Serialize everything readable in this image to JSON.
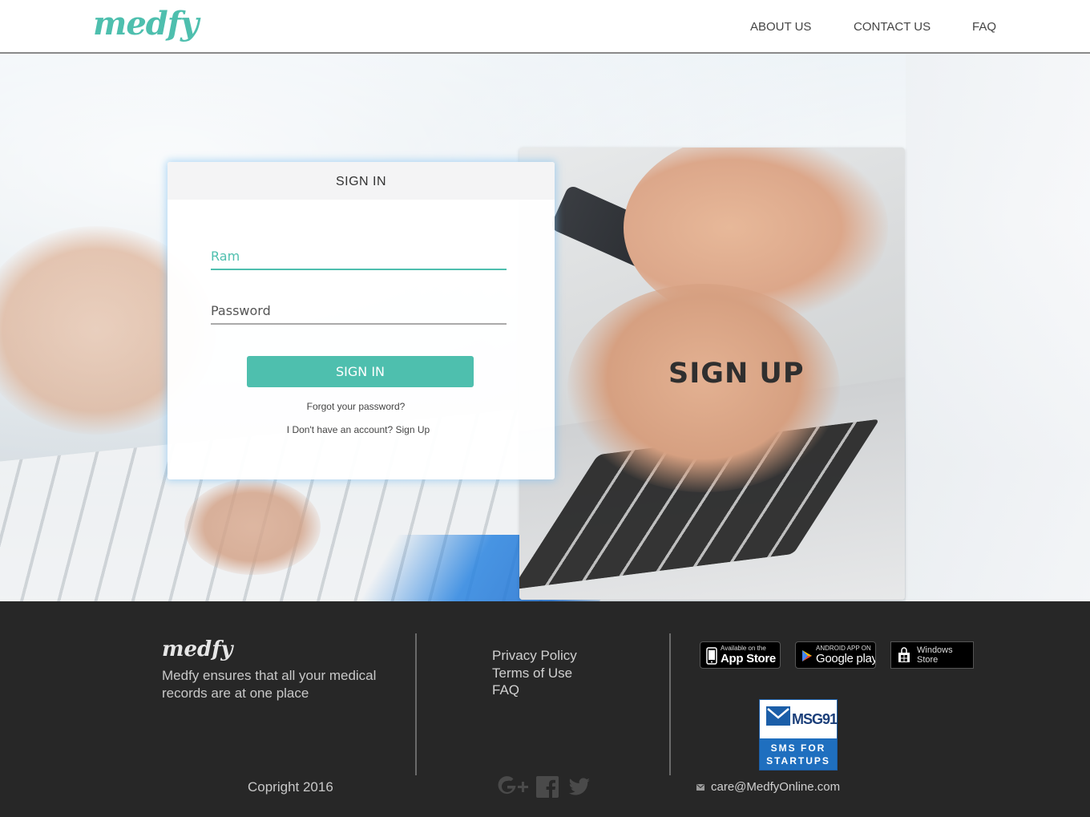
{
  "header": {
    "logo": "medfy",
    "nav": {
      "about": "ABOUT US",
      "contact": "CONTACT US",
      "faq": "FAQ"
    }
  },
  "signup_panel": {
    "title": "SIGN UP"
  },
  "signin": {
    "title": "SIGN IN",
    "username_value": "Ram",
    "password_placeholder": "Password",
    "button_label": "SIGN IN",
    "forgot_link": "Forgot your password?",
    "no_account_text": "I Don't have an account?",
    "signup_link": "Sign Up"
  },
  "footer": {
    "logo": "medfy",
    "tagline": "Medfy ensures that all your medical records are at one place",
    "links": {
      "privacy": "Privacy Policy",
      "terms": "Terms of Use",
      "faq": "FAQ"
    },
    "badges": {
      "apple_small": "Available on the",
      "apple_big": "App Store",
      "google_small": "ANDROID APP ON",
      "google_big": "Google play",
      "windows_line1": "Windows",
      "windows_line2": "Store"
    },
    "msg91": {
      "name": "MSG91",
      "line1": "SMS FOR",
      "line2": "STARTUPS"
    },
    "copyright": "Copright 2016",
    "email": "care@MedfyOnline.com",
    "social_icons": [
      "google-plus-icon",
      "facebook-icon",
      "twitter-icon"
    ]
  },
  "colors": {
    "accent": "#4ebfae",
    "footer_bg": "#272727"
  }
}
